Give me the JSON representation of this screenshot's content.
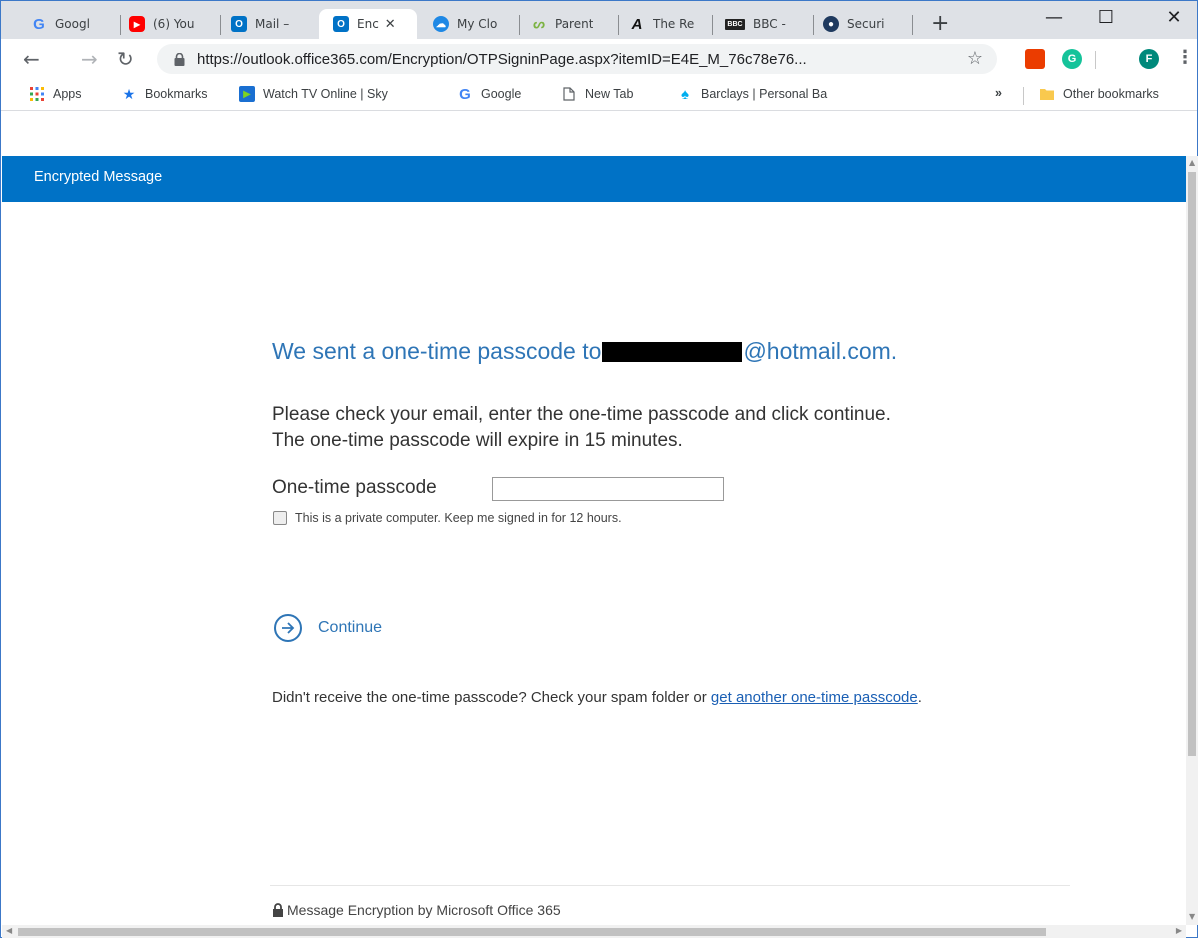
{
  "browser": {
    "tabs": [
      {
        "title": "Googl",
        "icon": "google-icon",
        "color": "#4285f4",
        "glyph": "G"
      },
      {
        "title": "(6) You",
        "icon": "youtube-icon",
        "color": "#ff0000",
        "glyph": "▶"
      },
      {
        "title": "Mail –",
        "icon": "outlook-icon",
        "color": "#0072c6",
        "glyph": "O"
      },
      {
        "title": "Enc",
        "icon": "outlook-icon",
        "color": "#0072c6",
        "glyph": "O",
        "active": true
      },
      {
        "title": "My Clo",
        "icon": "cloud-icon",
        "color": "#1e88e5",
        "glyph": "☁"
      },
      {
        "title": "Parent",
        "icon": "parentpay-icon",
        "color": "#7cb342",
        "glyph": "P"
      },
      {
        "title": "The Re",
        "icon": "the-register-icon",
        "color": "#111111",
        "glyph": "R"
      },
      {
        "title": "BBC -",
        "icon": "bbc-icon",
        "color": "#222222",
        "glyph": "B"
      },
      {
        "title": "Securi",
        "icon": "globe-icon",
        "color": "#1f3a5f",
        "glyph": "●"
      }
    ],
    "new_tab": "+",
    "window_controls": {
      "minimize": "—",
      "maximize": "☐",
      "close": "✕"
    },
    "url": "https://outlook.office365.com/Encryption/OTPSigninPage.aspx?itemID=E4E_M_76c78e76...",
    "profile_initial": "F",
    "grammarly_initial": "G",
    "bookmarks": [
      {
        "label": "Apps",
        "icon": "apps-grid-icon"
      },
      {
        "label": "Bookmarks",
        "icon": "star-icon"
      },
      {
        "label": "Watch TV Online | Sky",
        "icon": "sky-icon"
      },
      {
        "label": "Google",
        "icon": "google-icon"
      },
      {
        "label": "New Tab",
        "icon": "page-icon"
      },
      {
        "label": "Barclays | Personal Ba",
        "icon": "barclays-icon"
      }
    ],
    "overflow": "»",
    "other_bookmarks": "Other bookmarks"
  },
  "page": {
    "banner_title": "Encrypted Message",
    "headline_pre": "We sent a one-time passcode to",
    "headline_post": "@hotmail.com.",
    "instructions_line1": "Please check your email, enter the one-time passcode and click continue.",
    "instructions_line2": "The one-time passcode will expire in 15 minutes.",
    "otp_label": "One-time passcode",
    "otp_value": "",
    "keep_signed_in": "This is a private computer. Keep me signed in for 12 hours.",
    "continue_label": "Continue",
    "resend_pre": "Didn't receive the one-time passcode? Check your spam folder or ",
    "resend_link": "get another one-time passcode",
    "resend_post": ".",
    "footer": "Message Encryption by Microsoft Office 365"
  },
  "colors": {
    "brand_blue": "#0072c6",
    "headline_blue": "#2e75b6"
  }
}
